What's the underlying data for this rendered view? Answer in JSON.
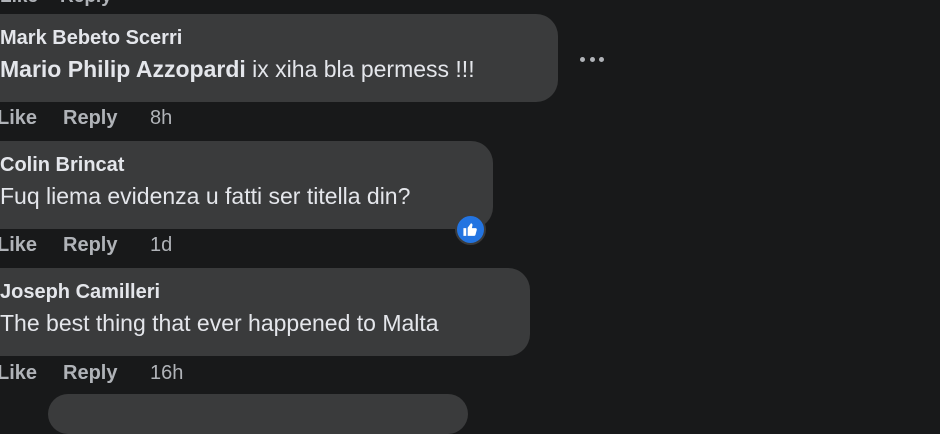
{
  "top_actions": {
    "like": "Like",
    "reply": "Reply",
    "time": ""
  },
  "comments": [
    {
      "author": "Mark Bebeto Scerri",
      "mention": "Mario Philip Azzopardi",
      "text": " ix xiha bla permess !!!",
      "like_label": "Like",
      "reply_label": "Reply",
      "time": "8h"
    },
    {
      "author": "Colin Brincat",
      "mention": "",
      "text": "Fuq liema evidenza u fatti ser titella din?",
      "like_label": "Like",
      "reply_label": "Reply",
      "time": "1d",
      "reaction_icon": "thumbs-up-icon",
      "reaction_color": "#2374e1"
    },
    {
      "author": "Joseph Camilleri",
      "mention": "",
      "text": "The best thing that ever happened to Malta",
      "like_label": "Like",
      "reply_label": "Reply",
      "time": "16h"
    }
  ],
  "more_options_icon": "more-options-icon",
  "colors": {
    "background": "#18191a",
    "bubble": "#3a3b3c",
    "primary_text": "#e4e6eb",
    "secondary_text": "#b0b3b8",
    "accent": "#2374e1"
  }
}
